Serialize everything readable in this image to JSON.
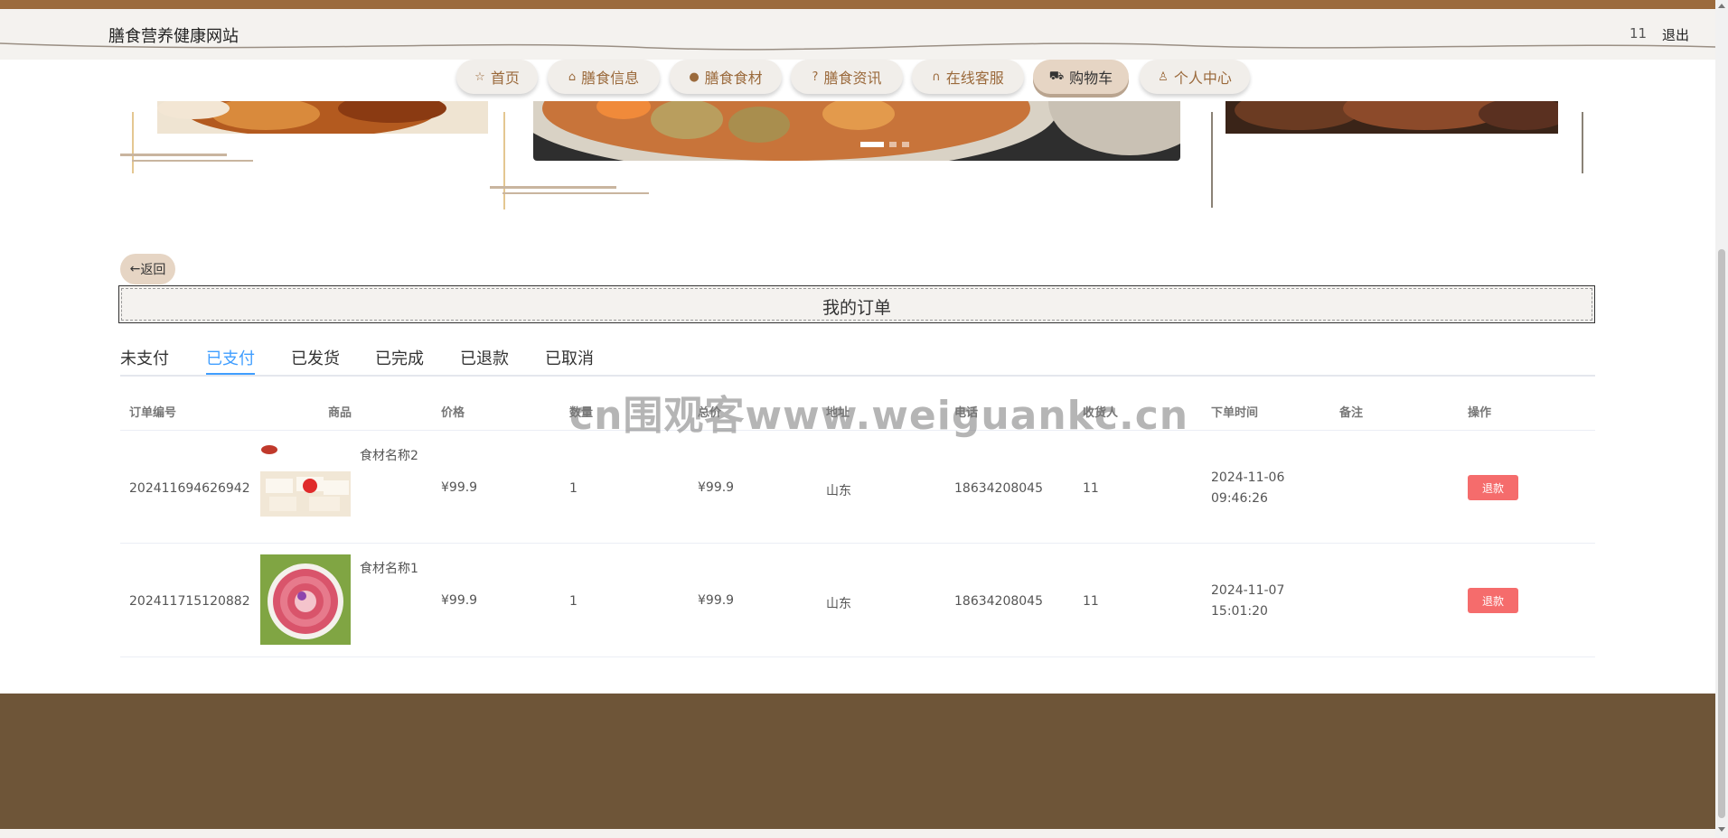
{
  "header": {
    "site_title": "膳食营养健康网站",
    "user_name": "11",
    "logout_label": "退出"
  },
  "nav": {
    "items": [
      {
        "label": "首页",
        "icon": "star-icon",
        "glyph": "☆"
      },
      {
        "label": "膳食信息",
        "icon": "bag-icon",
        "glyph": "⌂"
      },
      {
        "label": "膳食食材",
        "icon": "info-icon",
        "glyph": "❶"
      },
      {
        "label": "膳食资讯",
        "icon": "question-icon",
        "glyph": "❓"
      },
      {
        "label": "在线客服",
        "icon": "headset-icon",
        "glyph": "☊"
      },
      {
        "label": "购物车",
        "icon": "cart-icon",
        "glyph": "🛒"
      },
      {
        "label": "个人中心",
        "icon": "user-icon",
        "glyph": "♙"
      }
    ],
    "active_index": 5
  },
  "back_button": {
    "label": "返回",
    "icon": "arrow-left-icon"
  },
  "page_title": "我的订单",
  "tabs": {
    "items": [
      "未支付",
      "已支付",
      "已发货",
      "已完成",
      "已退款",
      "已取消"
    ],
    "active_index": 1
  },
  "table": {
    "headers": [
      "订单编号",
      "商品",
      "价格",
      "数量",
      "总价",
      "地址",
      "电话",
      "收货人",
      "下单时间",
      "备注",
      "操作"
    ],
    "rows": [
      {
        "order_no": "202411694626942",
        "product_name": "食材名称2",
        "price": "¥99.9",
        "quantity": "1",
        "total": "¥99.9",
        "address": "山东",
        "phone": "18634208045",
        "receiver": "11",
        "order_time": "2024-11-06 09:46:26",
        "remark": "",
        "action": "退款"
      },
      {
        "order_no": "202411715120882",
        "product_name": "食材名称1",
        "price": "¥99.9",
        "quantity": "1",
        "total": "¥99.9",
        "address": "山东",
        "phone": "18634208045",
        "receiver": "11",
        "order_time": "2024-11-07 15:01:20",
        "remark": "",
        "action": "退款"
      }
    ]
  },
  "watermark": "cn围观客www.weiguankc.cn",
  "colors": {
    "brand_brown": "#9b6a3c",
    "footer_brown": "#6e5538",
    "tab_active": "#409eff",
    "refund_button": "#f56c6c",
    "nav_active_bg": "#e6d5c4"
  }
}
